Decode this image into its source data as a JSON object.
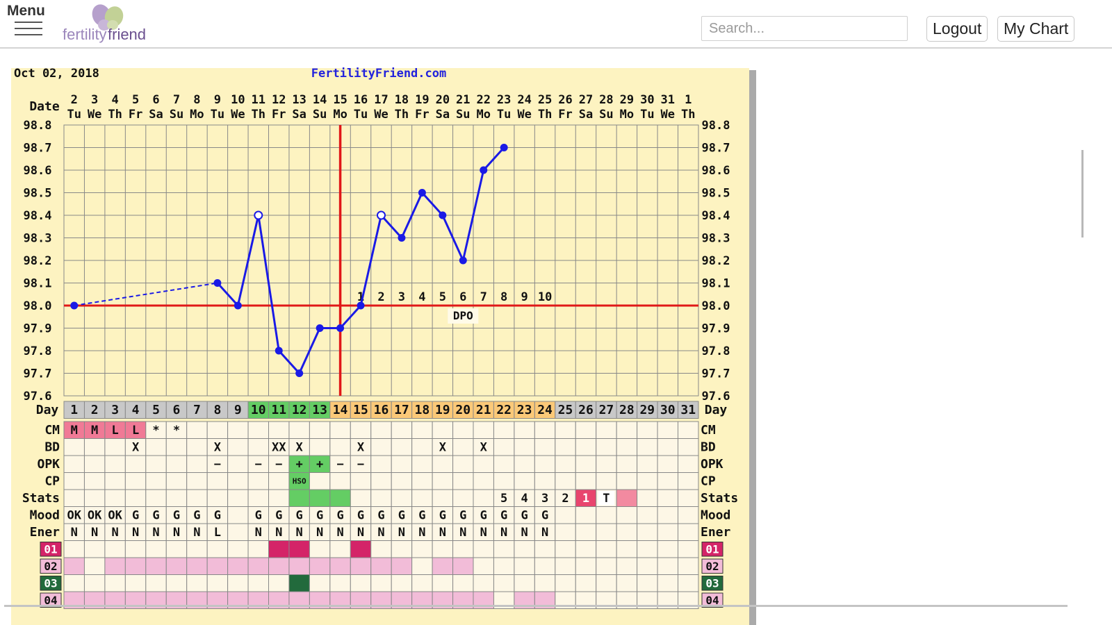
{
  "header": {
    "menu_label": "Menu",
    "logo_text_light": "fertility",
    "logo_text_bold": "friend",
    "search_placeholder": "Search...",
    "logout_label": "Logout",
    "mychart_label": "My Chart"
  },
  "chart_data": {
    "type": "line",
    "header_date": "Oct 02, 2018",
    "site": "FertilityFriend.com",
    "row_label_date": "Date",
    "row_label_day": "Day",
    "dates": [
      {
        "num": "2",
        "dow": "Tu"
      },
      {
        "num": "3",
        "dow": "We"
      },
      {
        "num": "4",
        "dow": "Th"
      },
      {
        "num": "5",
        "dow": "Fr"
      },
      {
        "num": "6",
        "dow": "Sa"
      },
      {
        "num": "7",
        "dow": "Su"
      },
      {
        "num": "8",
        "dow": "Mo"
      },
      {
        "num": "9",
        "dow": "Tu"
      },
      {
        "num": "10",
        "dow": "We"
      },
      {
        "num": "11",
        "dow": "Th"
      },
      {
        "num": "12",
        "dow": "Fr"
      },
      {
        "num": "13",
        "dow": "Sa"
      },
      {
        "num": "14",
        "dow": "Su"
      },
      {
        "num": "15",
        "dow": "Mo"
      },
      {
        "num": "16",
        "dow": "Tu"
      },
      {
        "num": "17",
        "dow": "We"
      },
      {
        "num": "18",
        "dow": "Th"
      },
      {
        "num": "19",
        "dow": "Fr"
      },
      {
        "num": "20",
        "dow": "Sa"
      },
      {
        "num": "21",
        "dow": "Su"
      },
      {
        "num": "22",
        "dow": "Mo"
      },
      {
        "num": "23",
        "dow": "Tu"
      },
      {
        "num": "24",
        "dow": "We"
      },
      {
        "num": "25",
        "dow": "Th"
      },
      {
        "num": "26",
        "dow": "Fr"
      },
      {
        "num": "27",
        "dow": "Sa"
      },
      {
        "num": "28",
        "dow": "Su"
      },
      {
        "num": "29",
        "dow": "Mo"
      },
      {
        "num": "30",
        "dow": "Tu"
      },
      {
        "num": "31",
        "dow": "We"
      },
      {
        "num": "1",
        "dow": "Th"
      }
    ],
    "days": [
      "1",
      "2",
      "3",
      "4",
      "5",
      "6",
      "7",
      "8",
      "9",
      "10",
      "11",
      "12",
      "13",
      "14",
      "15",
      "16",
      "17",
      "18",
      "19",
      "20",
      "21",
      "22",
      "23",
      "24",
      "25",
      "26",
      "27",
      "28",
      "29",
      "30",
      "31"
    ],
    "y_ticks": [
      "98.8",
      "98.7",
      "98.6",
      "98.5",
      "98.4",
      "98.3",
      "98.2",
      "98.1",
      "98.0",
      "97.9",
      "97.8",
      "97.7",
      "97.6"
    ],
    "ylim": [
      97.6,
      98.8
    ],
    "temperatures": [
      {
        "day": 1,
        "temp": 98.0,
        "type": "solid"
      },
      {
        "day": 8,
        "temp": 98.1,
        "type": "solid"
      },
      {
        "day": 9,
        "temp": 98.0,
        "type": "solid"
      },
      {
        "day": 10,
        "temp": 98.4,
        "type": "open"
      },
      {
        "day": 11,
        "temp": 97.8,
        "type": "solid"
      },
      {
        "day": 12,
        "temp": 97.7,
        "type": "solid"
      },
      {
        "day": 13,
        "temp": 97.9,
        "type": "solid"
      },
      {
        "day": 14,
        "temp": 97.9,
        "type": "solid"
      },
      {
        "day": 15,
        "temp": 98.0,
        "type": "solid"
      },
      {
        "day": 16,
        "temp": 98.4,
        "type": "open"
      },
      {
        "day": 17,
        "temp": 98.3,
        "type": "solid"
      },
      {
        "day": 18,
        "temp": 98.5,
        "type": "solid"
      },
      {
        "day": 19,
        "temp": 98.4,
        "type": "solid"
      },
      {
        "day": 20,
        "temp": 98.2,
        "type": "solid"
      },
      {
        "day": 21,
        "temp": 98.6,
        "type": "solid"
      },
      {
        "day": 22,
        "temp": 98.7,
        "type": "solid"
      }
    ],
    "coverline": 98.0,
    "ovulation_day": 14,
    "dpo_labels": [
      "1",
      "2",
      "3",
      "4",
      "5",
      "6",
      "7",
      "8",
      "9",
      "10"
    ],
    "dpo_start_day": 15,
    "dpo_text": "DPO",
    "rows": [
      {
        "label": "CM",
        "cells": [
          "M",
          "M",
          "L",
          "L",
          "*",
          "*",
          "",
          "",
          "",
          "",
          "",
          "",
          "",
          "",
          "",
          "",
          "",
          "",
          "",
          "",
          "",
          "",
          "",
          "",
          "",
          "",
          "",
          "",
          "",
          "",
          ""
        ]
      },
      {
        "label": "BD",
        "cells": [
          "",
          "",
          "",
          "X",
          "",
          "",
          "",
          "X",
          "",
          "",
          "XX",
          "X",
          "",
          "",
          "X",
          "",
          "",
          "",
          "X",
          "",
          "X",
          "",
          "",
          "",
          "",
          "",
          "",
          "",
          "",
          "",
          ""
        ]
      },
      {
        "label": "OPK",
        "cells": [
          "",
          "",
          "",
          "",
          "",
          "",
          "",
          "−",
          "",
          "−",
          "−",
          "+",
          "+",
          "−",
          "−",
          "",
          "",
          "",
          "",
          "",
          "",
          "",
          "",
          "",
          "",
          "",
          "",
          "",
          "",
          "",
          ""
        ]
      },
      {
        "label": "CP",
        "cells": [
          "",
          "",
          "",
          "",
          "",
          "",
          "",
          "",
          "",
          "",
          "",
          "HSO",
          "",
          "",
          "",
          "",
          "",
          "",
          "",
          "",
          "",
          "",
          "",
          "",
          "",
          "",
          "",
          "",
          "",
          "",
          ""
        ]
      },
      {
        "label": "Stats",
        "cells": [
          "",
          "",
          "",
          "",
          "",
          "",
          "",
          "",
          "",
          "",
          "",
          "",
          "",
          "",
          "",
          "",
          "",
          "",
          "",
          "",
          "",
          "5",
          "4",
          "3",
          "2",
          "1",
          "T",
          "",
          "",
          "",
          ""
        ]
      },
      {
        "label": "Mood",
        "cells": [
          "OK",
          "OK",
          "OK",
          "G",
          "G",
          "G",
          "G",
          "G",
          "",
          "G",
          "G",
          "G",
          "G",
          "G",
          "G",
          "G",
          "G",
          "G",
          "G",
          "G",
          "G",
          "G",
          "G",
          "G",
          "",
          "",
          "",
          "",
          "",
          "",
          ""
        ]
      },
      {
        "label": "Ener",
        "cells": [
          "N",
          "N",
          "N",
          "N",
          "N",
          "N",
          "N",
          "L",
          "",
          "N",
          "N",
          "N",
          "N",
          "N",
          "N",
          "N",
          "N",
          "N",
          "N",
          "N",
          "N",
          "N",
          "N",
          "N",
          "",
          "",
          "",
          "",
          "",
          "",
          ""
        ]
      },
      {
        "label": "01",
        "cells": [
          "",
          "",
          "",
          "",
          "",
          "",
          "",
          "",
          "",
          "",
          "",
          "",
          "",
          "",
          "",
          "",
          "",
          "",
          "",
          "",
          "",
          "",
          "",
          "",
          "",
          "",
          "",
          "",
          "",
          "",
          ""
        ]
      },
      {
        "label": "02",
        "cells": [
          "",
          "",
          "",
          "",
          "",
          "",
          "",
          "",
          "",
          "",
          "",
          "",
          "",
          "",
          "",
          "",
          "",
          "",
          "",
          "",
          "",
          "",
          "",
          "",
          "",
          "",
          "",
          "",
          "",
          "",
          ""
        ]
      },
      {
        "label": "03",
        "cells": [
          "",
          "",
          "",
          "",
          "",
          "",
          "",
          "",
          "",
          "",
          "",
          "",
          "",
          "",
          "",
          "",
          "",
          "",
          "",
          "",
          "",
          "",
          "",
          "",
          "",
          "",
          "",
          "",
          "",
          "",
          ""
        ]
      },
      {
        "label": "04",
        "cells": [
          "",
          "",
          "",
          "",
          "",
          "",
          "",
          "",
          "",
          "",
          "",
          "",
          "",
          "",
          "",
          "",
          "",
          "",
          "",
          "",
          "",
          "",
          "",
          "",
          "",
          "",
          "",
          "",
          "",
          "",
          ""
        ]
      }
    ],
    "colors": {
      "background": "#fdf3c1",
      "cell": "#fdf7e6",
      "grid": "#888888",
      "line": "#1a1ae6",
      "coverline": "#e01818",
      "fertile_green": "#64cd64",
      "luteal_orange": "#fbc978",
      "day_gray": "#c8c8c8",
      "cm_pink": "#f07a96",
      "pink_light": "#f2bcd8",
      "crimson": "#d42468",
      "dark_green": "#226a3c",
      "stat_red": "#e8456e",
      "stat_pink": "#f28aa0"
    }
  }
}
